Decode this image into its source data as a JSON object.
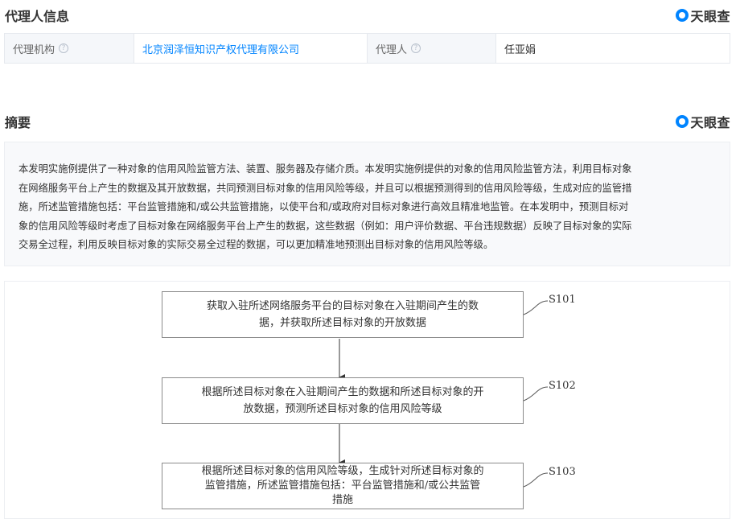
{
  "agent_section": {
    "title": "代理人信息",
    "brand": "天眼查",
    "table": {
      "agency_label": "代理机构",
      "agency_value": "北京润泽恒知识产权代理有限公司",
      "agent_label": "代理人",
      "agent_value": "任亚娟"
    }
  },
  "abstract_section": {
    "title": "摘要",
    "brand": "天眼查",
    "lines": [
      "本发明实施例提供了一种对象的信用风险监管方法、装置、服务器及存储介质。本发明实施例提供的对象的信用风险监管方法，利用目标对象",
      "在网络服务平台上产生的数据及其开放数据，共同预测目标对象的信用风险等级，并且可以根据预测得到的信用风险等级，生成对应的监管措",
      "施，所述监管措施包括：平台监管措施和/或公共监管措施，以使平台和/或政府对目标对象进行高效且精准地监管。在本发明中，预测目标对",
      "象的信用风险等级时考虑了目标对象在网络服务平台上产生的数据，这些数据（例如：用户评价数据、平台违规数据）反映了目标对象的实际",
      "交易全过程，利用反映目标对象的实际交易全过程的数据，可以更加精准地预测出目标对象的信用风险等级。"
    ]
  },
  "flowchart": {
    "steps": [
      {
        "label": "S101",
        "lines": [
          "获取入驻所述网络服务平台的目标对象在入驻期间产生的数",
          "据，并获取所述目标对象的开放数据"
        ]
      },
      {
        "label": "S102",
        "lines": [
          "根据所述目标对象在入驻期间产生的数据和所述目标对象的开",
          "放数据，预测所述目标对象的信用风险等级"
        ]
      },
      {
        "label": "S103",
        "lines": [
          "根据所述目标对象的信用风险等级，生成针对所述目标对象的",
          "监管措施，所述监管措施包括：平台监管措施和/或公共监管",
          "措施"
        ]
      }
    ]
  }
}
